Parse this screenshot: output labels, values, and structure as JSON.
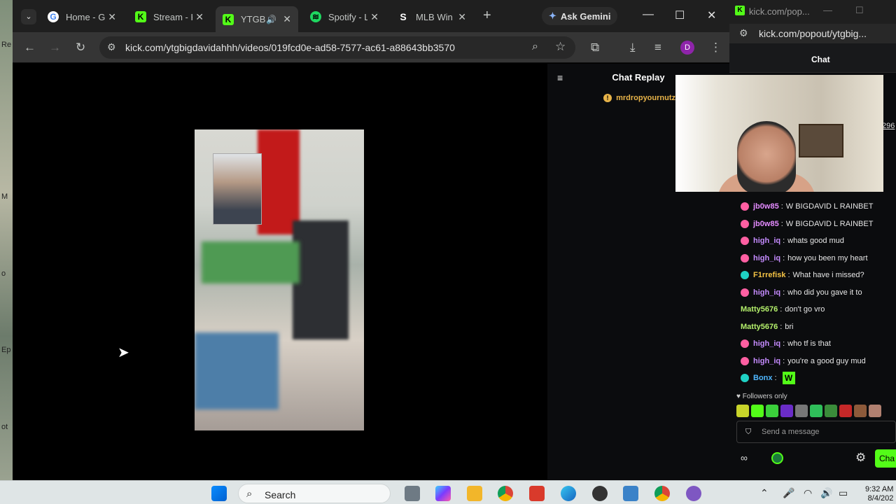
{
  "desktop": {
    "left_labels": [
      "Re",
      "M",
      "o",
      "Ep",
      "ot"
    ]
  },
  "browser": {
    "tabs": [
      {
        "label": "Home - G",
        "icon": "google-icon"
      },
      {
        "label": "Stream - K",
        "icon": "kick-icon"
      },
      {
        "label": "YTGBi",
        "icon": "kick-icon",
        "active": true
      },
      {
        "label": "Spotify - L",
        "icon": "spotify-icon"
      },
      {
        "label": "MLB Win",
        "icon": "sportsbook-icon"
      }
    ],
    "new_tab": "+",
    "gemini_label": "Ask Gemini",
    "url": "kick.com/ytgbigdavidahhh/videos/019fcd0e-ad58-7577-ac61-a88643bb3570",
    "profile_initial": "D"
  },
  "chat_replay": {
    "title": "Chat Replay",
    "pinned_user": "mrdropyournutz"
  },
  "popout": {
    "title": "kick.com/pop...",
    "url": "kick.com/popout/ytgbig...",
    "tab_label": "Chat",
    "partial_number": "296",
    "messages": [
      {
        "user": "jb0w85",
        "text": "W BIGDAVID L RAINBET",
        "color": "#e48bff",
        "badge": "#ff5fa2"
      },
      {
        "user": "jb0w85",
        "text": "W BIGDAVID L RAINBET",
        "color": "#e48bff",
        "badge": "#ff5fa2"
      },
      {
        "user": "high_iq",
        "text": "whats good mud",
        "color": "#c58bff",
        "badge": "#ff5fa2"
      },
      {
        "user": "high_iq",
        "text": "how you been my heart",
        "color": "#c58bff",
        "badge": "#ff5fa2"
      },
      {
        "user": "F1rrefisk",
        "text": "What have i missed?",
        "color": "#f6c445",
        "badge": "#1fd1c4"
      },
      {
        "user": "high_iq",
        "text": "who did you gave it to",
        "color": "#c58bff",
        "badge": "#ff5fa2"
      },
      {
        "user": "Matty5676",
        "text": "don't go vro",
        "color": "#b4f06b",
        "badge": ""
      },
      {
        "user": "Matty5676",
        "text": "bri",
        "color": "#b4f06b",
        "badge": ""
      },
      {
        "user": "high_iq",
        "text": "who tf is that",
        "color": "#c58bff",
        "badge": "#ff5fa2"
      },
      {
        "user": "high_iq",
        "text": "you're a good guy mud",
        "color": "#c58bff",
        "badge": "#ff5fa2"
      },
      {
        "user": "Bonx",
        "text": "",
        "color": "#4fb7ff",
        "badge": "#1fd1c4",
        "emote": "W"
      }
    ],
    "followers_only": "Followers only",
    "input_placeholder": "Send a message",
    "chat_button": "Cha"
  },
  "taskbar": {
    "search_placeholder": "Search",
    "time": "9:32 AM",
    "date": "8/4/202"
  }
}
